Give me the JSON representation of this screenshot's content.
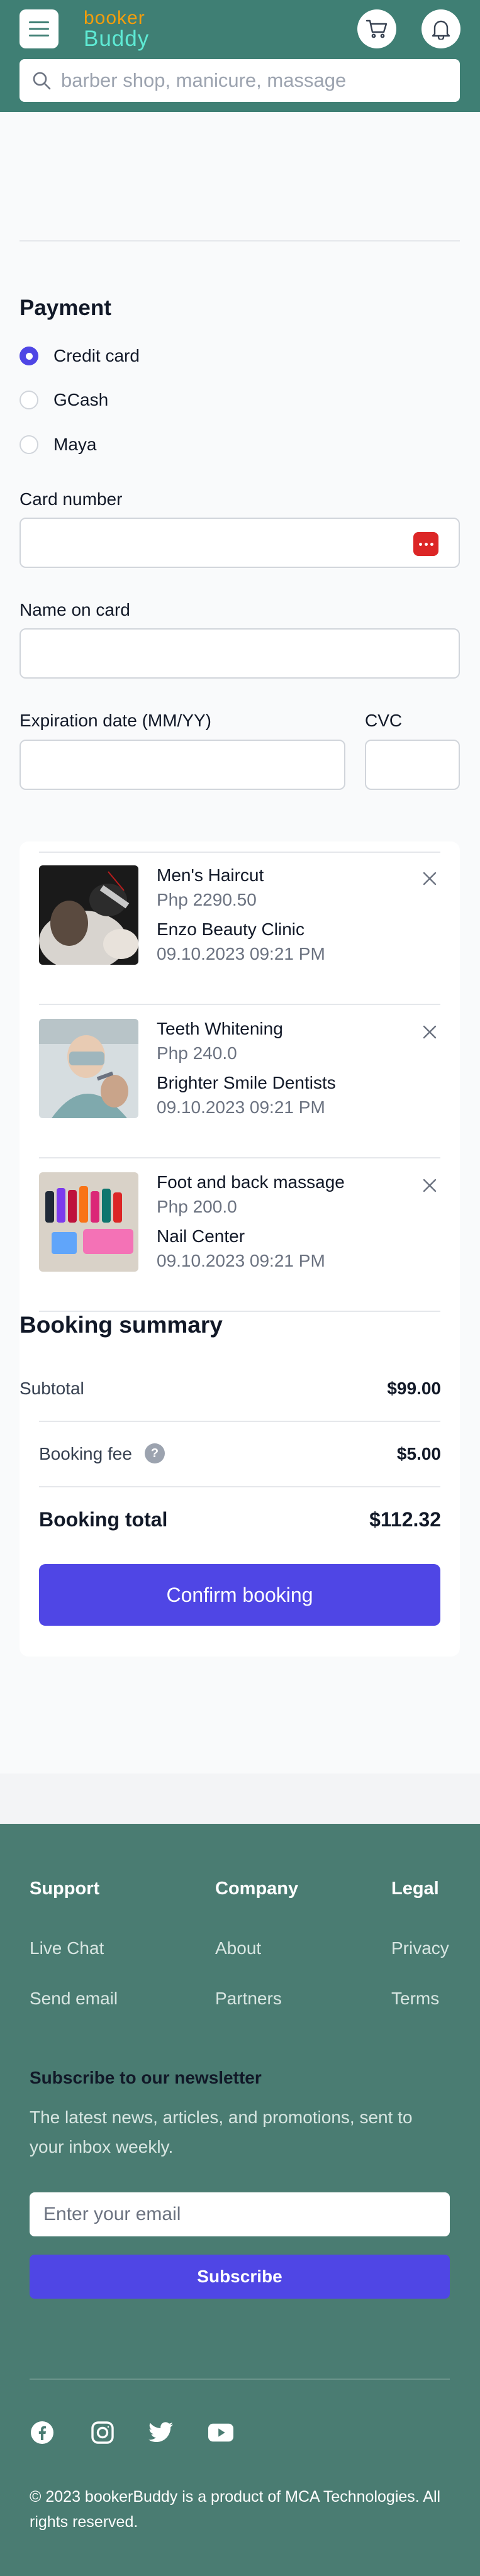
{
  "header": {
    "logo_line1": "booker",
    "logo_line2": "Buddy",
    "search_placeholder": "barber shop, manicure, massage"
  },
  "payment": {
    "title": "Payment",
    "methods": [
      "Credit card",
      "GCash",
      "Maya"
    ],
    "selected_method": "Credit card",
    "card_number_label": "Card number",
    "card_number_value": "",
    "name_label": "Name on card",
    "name_value": "",
    "expiration_label": "Expiration date (MM/YY)",
    "expiration_value": "",
    "cvc_label": "CVC",
    "cvc_value": ""
  },
  "cart": {
    "items": [
      {
        "name": "Men's Haircut",
        "price": "Php 2290.50",
        "vendor": "Enzo Beauty Clinic",
        "datetime": "09.10.2023 09:21 PM"
      },
      {
        "name": "Teeth Whitening",
        "price": "Php 240.0",
        "vendor": "Brighter Smile Dentists",
        "datetime": "09.10.2023 09:21 PM"
      },
      {
        "name": "Foot and back massage",
        "price": "Php 200.0",
        "vendor": "Nail Center",
        "datetime": "09.10.2023 09:21 PM"
      }
    ]
  },
  "summary": {
    "title": "Booking summary",
    "subtotal_label": "Subtotal",
    "subtotal_value": "$99.00",
    "fee_label": "Booking fee",
    "fee_value": "$5.00",
    "total_label": "Booking total",
    "total_value": "$112.32",
    "confirm_label": "Confirm booking"
  },
  "footer": {
    "support_heading": "Support",
    "support_links": [
      "Live Chat",
      "Send email"
    ],
    "company_heading": "Company",
    "company_links": [
      "About",
      "Partners"
    ],
    "legal_heading": "Legal",
    "legal_links": [
      "Privacy",
      "Terms"
    ],
    "newsletter_title": "Subscribe to our newsletter",
    "newsletter_desc": "The latest news, articles, and promotions, sent to your inbox weekly.",
    "newsletter_placeholder": "Enter your email",
    "subscribe_label": "Subscribe",
    "social_icons": [
      "facebook-icon",
      "instagram-icon",
      "twitter-icon",
      "youtube-icon"
    ],
    "copyright": "© 2023 bookerBuddy is a product of MCA Technologies. All rights reserved."
  },
  "colors": {
    "header_bg": "#3f7f74",
    "footer_bg": "#4a7c72",
    "accent": "#4f46e5",
    "logo_orange": "#f59e0b",
    "logo_teal": "#5eead4"
  }
}
